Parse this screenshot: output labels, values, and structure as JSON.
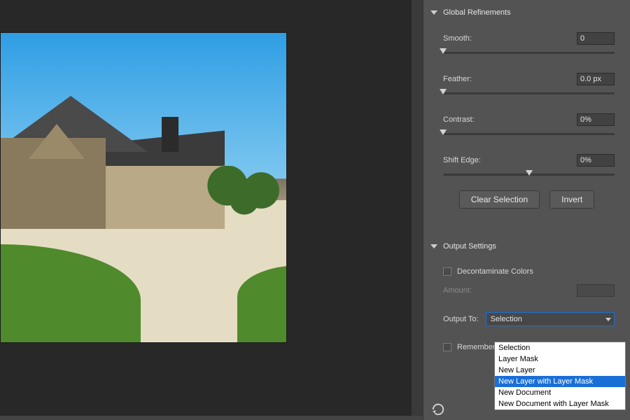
{
  "image_alt": "House exterior photo preview",
  "global": {
    "heading": "Global Refinements",
    "smooth": {
      "label": "Smooth:",
      "value": "0",
      "thumb_pct": 0
    },
    "feather": {
      "label": "Feather:",
      "value": "0.0 px",
      "thumb_pct": 0
    },
    "contrast": {
      "label": "Contrast:",
      "value": "0%",
      "thumb_pct": 0
    },
    "shift": {
      "label": "Shift Edge:",
      "value": "0%",
      "thumb_pct": 50
    },
    "clear_btn": "Clear Selection",
    "invert_btn": "Invert"
  },
  "output": {
    "heading": "Output Settings",
    "decon_label": "Decontaminate Colors",
    "amount_label": "Amount:",
    "output_to_label": "Output To:",
    "selected_value": "Selection",
    "options": [
      "Selection",
      "Layer Mask",
      "New Layer",
      "New Layer with Layer Mask",
      "New Document",
      "New Document with Layer Mask"
    ],
    "highlight_index": 3,
    "remember_label": "Remember Settings"
  },
  "reset_title": "Reset"
}
